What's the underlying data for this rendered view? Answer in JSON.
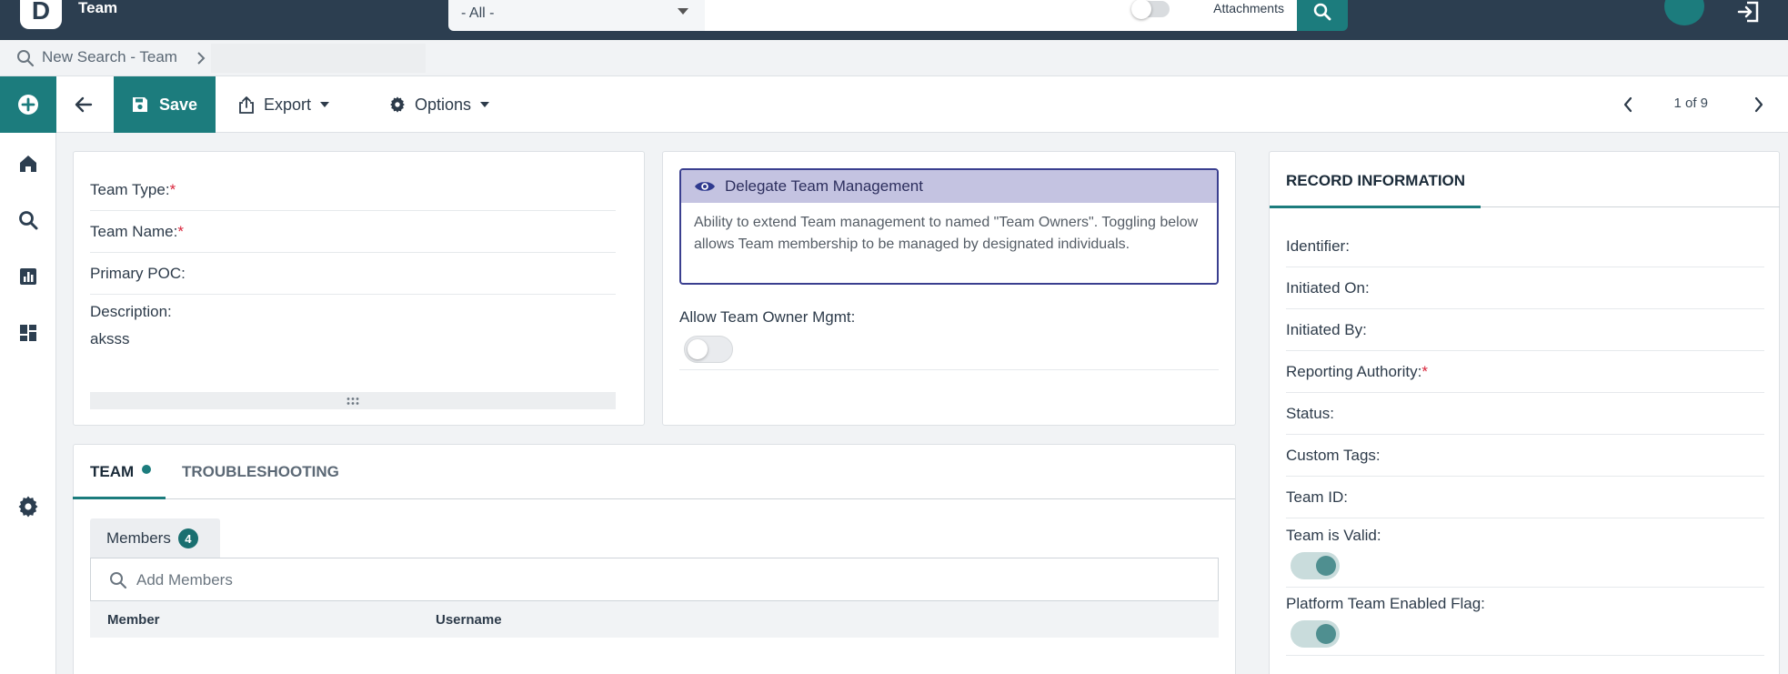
{
  "topbar": {
    "logo_letter": "D",
    "app_title": "Team",
    "scope_value": "- All -",
    "attachments_label": "Attachments"
  },
  "breadcrumb": {
    "text": "New Search - Team"
  },
  "toolbar": {
    "save_label": "Save",
    "export_label": "Export",
    "options_label": "Options",
    "pager_text": "1 of 9"
  },
  "team_form": {
    "team_type_label": "Team Type:",
    "team_name_label": "Team Name:",
    "primary_poc_label": "Primary POC:",
    "description_label": "Description:",
    "description_value": "aksss",
    "required_mark": "*"
  },
  "delegate": {
    "title": "Delegate Team Management",
    "body": "Ability to extend Team management to named \"Team Owners\". Toggling below allows Team membership to be managed by designated individuals.",
    "toggle_label": "Allow Team Owner Mgmt:",
    "toggle_on": false
  },
  "tabs": {
    "items": [
      {
        "label": "TEAM",
        "active": true
      },
      {
        "label": "TROUBLESHOOTING",
        "active": false
      }
    ],
    "members_label": "Members",
    "members_count": "4",
    "add_members_placeholder": "Add Members",
    "columns": [
      "Member",
      "Username"
    ]
  },
  "record_info": {
    "title": "RECORD INFORMATION",
    "identifier_label": "Identifier:",
    "initiated_on_label": "Initiated On:",
    "initiated_by_label": "Initiated By:",
    "reporting_authority_label": "Reporting Authority:",
    "status_label": "Status:",
    "custom_tags_label": "Custom Tags:",
    "team_id_label": "Team ID:",
    "team_valid_label": "Team is Valid:",
    "team_valid_on": true,
    "platform_flag_label": "Platform Team Enabled Flag:",
    "platform_flag_on": true
  },
  "colors": {
    "navy": "#2c3e50",
    "teal": "#1c7c7d",
    "required": "#d9263c",
    "delegate_header": "#c4c3e1",
    "delegate_border": "#3a3f8f"
  }
}
